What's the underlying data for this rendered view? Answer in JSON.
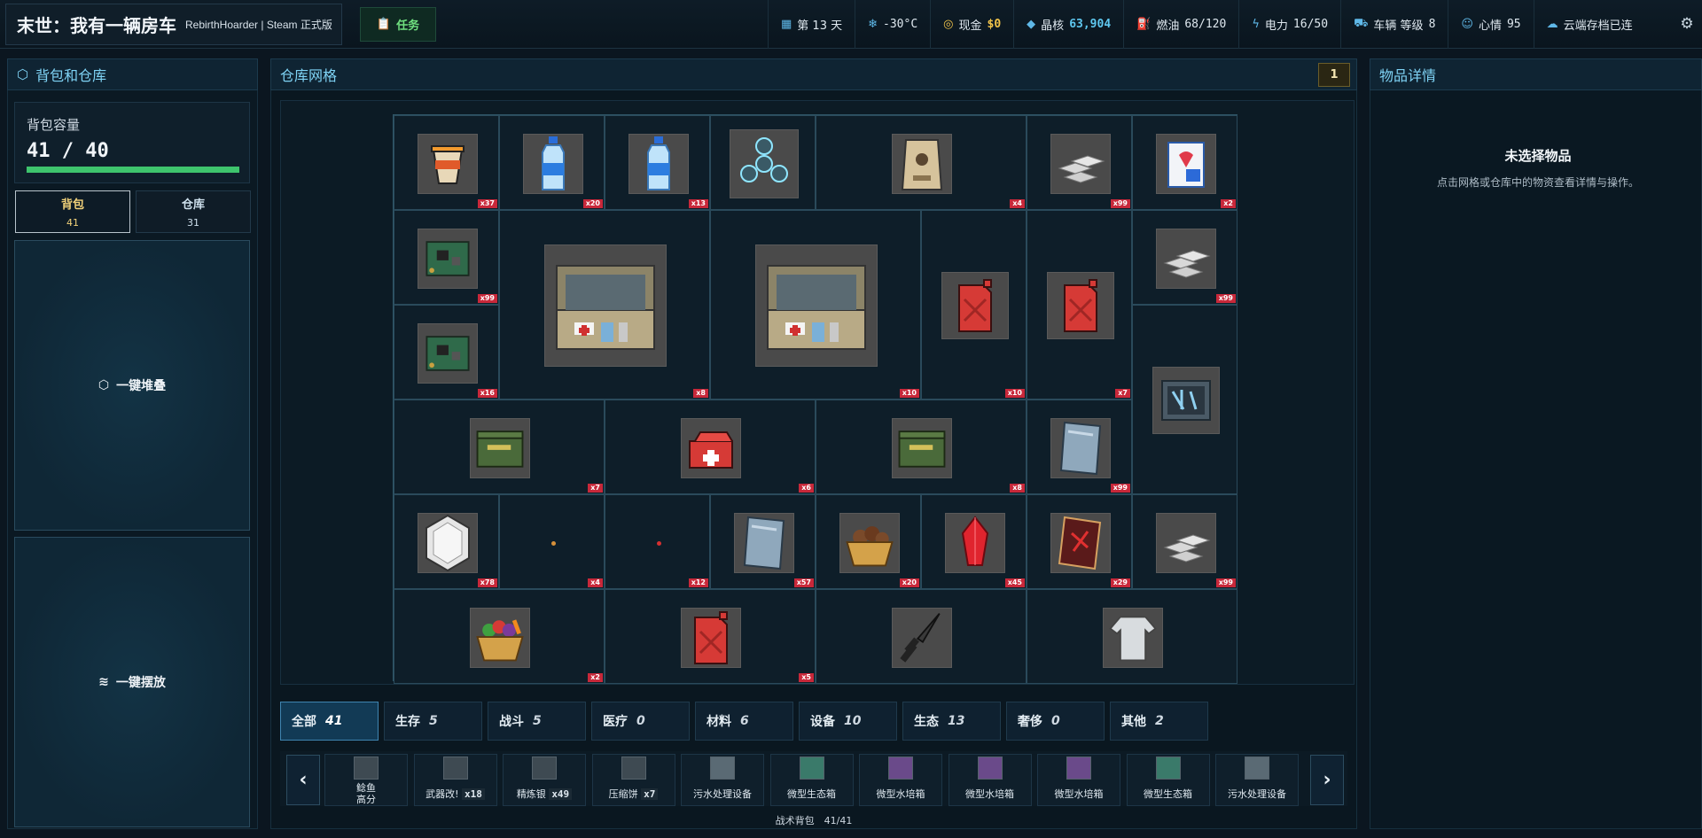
{
  "header": {
    "game_title": "末世：我有一辆房车",
    "subtitle": "RebirthHoarder | Steam 正式版",
    "task_label": "任务",
    "stats": [
      {
        "icon": "calendar-icon",
        "label": "第 13 天",
        "value": ""
      },
      {
        "icon": "snowflake-icon",
        "label": "",
        "value": "-30°C"
      },
      {
        "icon": "coin-icon",
        "label": "现金",
        "value": "$0"
      },
      {
        "icon": "crystal-icon",
        "label": "晶核",
        "value": "63,904"
      },
      {
        "icon": "fuel-icon",
        "label": "燃油",
        "value": "68/120"
      },
      {
        "icon": "lightning-icon",
        "label": "电力",
        "value": "16/50"
      },
      {
        "icon": "truck-icon",
        "label": "车辆 等级",
        "value": "8"
      },
      {
        "icon": "smile-icon",
        "label": "心情",
        "value": "95"
      },
      {
        "icon": "cloud-icon",
        "label": "云端存档已连",
        "value": ""
      }
    ]
  },
  "left_panel": {
    "title": "背包和仓库",
    "capacity_label": "背包容量",
    "capacity_value": "41 / 40",
    "capacity_fraction": 1.0,
    "tabs": [
      {
        "label": "背包",
        "count": "41"
      },
      {
        "label": "仓库",
        "count": "31"
      }
    ],
    "stack_button": "一键堆叠",
    "place_button": "一键摆放"
  },
  "center_panel": {
    "title": "仓库网格",
    "page_badge": "1",
    "items": [
      {
        "name": "cup-noodle",
        "qty": "x37"
      },
      {
        "name": "water-bottle",
        "qty": "x20"
      },
      {
        "name": "water-bottle",
        "qty": "x13"
      },
      {
        "name": "fidget-spinner",
        "qty": ""
      },
      {
        "name": "pet-food-bag",
        "qty": "x4"
      },
      {
        "name": "silver-ingots",
        "qty": "x99"
      },
      {
        "name": "medicine-box",
        "qty": "x2"
      },
      {
        "name": "circuit-board",
        "qty": "x99"
      },
      {
        "name": "first-aid-case",
        "qty": "x8"
      },
      {
        "name": "first-aid-case",
        "qty": "x10"
      },
      {
        "name": "jerry-can",
        "qty": "x10"
      },
      {
        "name": "jerry-can",
        "qty": "x7"
      },
      {
        "name": "silver-ingots",
        "qty": "x99"
      },
      {
        "name": "circuit-board",
        "qty": "x16"
      },
      {
        "name": "tool-case",
        "qty": ""
      },
      {
        "name": "ammo-box",
        "qty": "x7"
      },
      {
        "name": "red-toolbox",
        "qty": "x6"
      },
      {
        "name": "ammo-box",
        "qty": "x8"
      },
      {
        "name": "metal-plate",
        "qty": "x99"
      },
      {
        "name": "crystal-hexagon",
        "qty": "x78"
      },
      {
        "name": "small-seed",
        "qty": "x4"
      },
      {
        "name": "red-seed",
        "qty": "x12"
      },
      {
        "name": "metal-plate",
        "qty": "x57"
      },
      {
        "name": "potato-basket",
        "qty": "x20"
      },
      {
        "name": "red-crystal",
        "qty": "x45"
      },
      {
        "name": "rune-card",
        "qty": "x29"
      },
      {
        "name": "silver-ingots",
        "qty": "x99"
      },
      {
        "name": "vegetable-basket",
        "qty": "x2"
      },
      {
        "name": "jerry-can",
        "qty": "x5"
      },
      {
        "name": "combat-knife",
        "qty": ""
      },
      {
        "name": "sweater",
        "qty": ""
      }
    ],
    "categories": [
      {
        "label": "全部",
        "count": "41"
      },
      {
        "label": "生存",
        "count": "5"
      },
      {
        "label": "战斗",
        "count": "5"
      },
      {
        "label": "医疗",
        "count": "0"
      },
      {
        "label": "材料",
        "count": "6"
      },
      {
        "label": "设备",
        "count": "10"
      },
      {
        "label": "生态",
        "count": "13"
      },
      {
        "label": "奢侈",
        "count": "0"
      },
      {
        "label": "其他",
        "count": "2"
      }
    ],
    "belt": [
      {
        "label": "鲶鱼",
        "label2": "高分",
        "qty": ""
      },
      {
        "label": "武器改!",
        "qty": "x18"
      },
      {
        "label": "精炼银",
        "qty": "x49"
      },
      {
        "label": "压缩饼",
        "qty": "x7"
      },
      {
        "label": "污水处理设备",
        "qty": ""
      },
      {
        "label": "微型生态箱",
        "qty": ""
      },
      {
        "label": "微型水培箱",
        "qty": ""
      },
      {
        "label": "微型水培箱",
        "qty": ""
      },
      {
        "label": "微型水培箱",
        "qty": ""
      },
      {
        "label": "微型生态箱",
        "qty": ""
      },
      {
        "label": "污水处理设备",
        "qty": ""
      }
    ],
    "belt_prev": "‹",
    "belt_next": "›",
    "belt_footer": "战术背包　41/41"
  },
  "right_panel": {
    "title": "物品详情",
    "empty_title": "未选择物品",
    "empty_desc": "点击网格或仓库中的物资查看详情与操作。"
  },
  "colors": {
    "accent": "#7fd3f5",
    "badge_red": "#c8283a",
    "gold": "#f2c44a",
    "progress_green": "#3ec46d"
  }
}
